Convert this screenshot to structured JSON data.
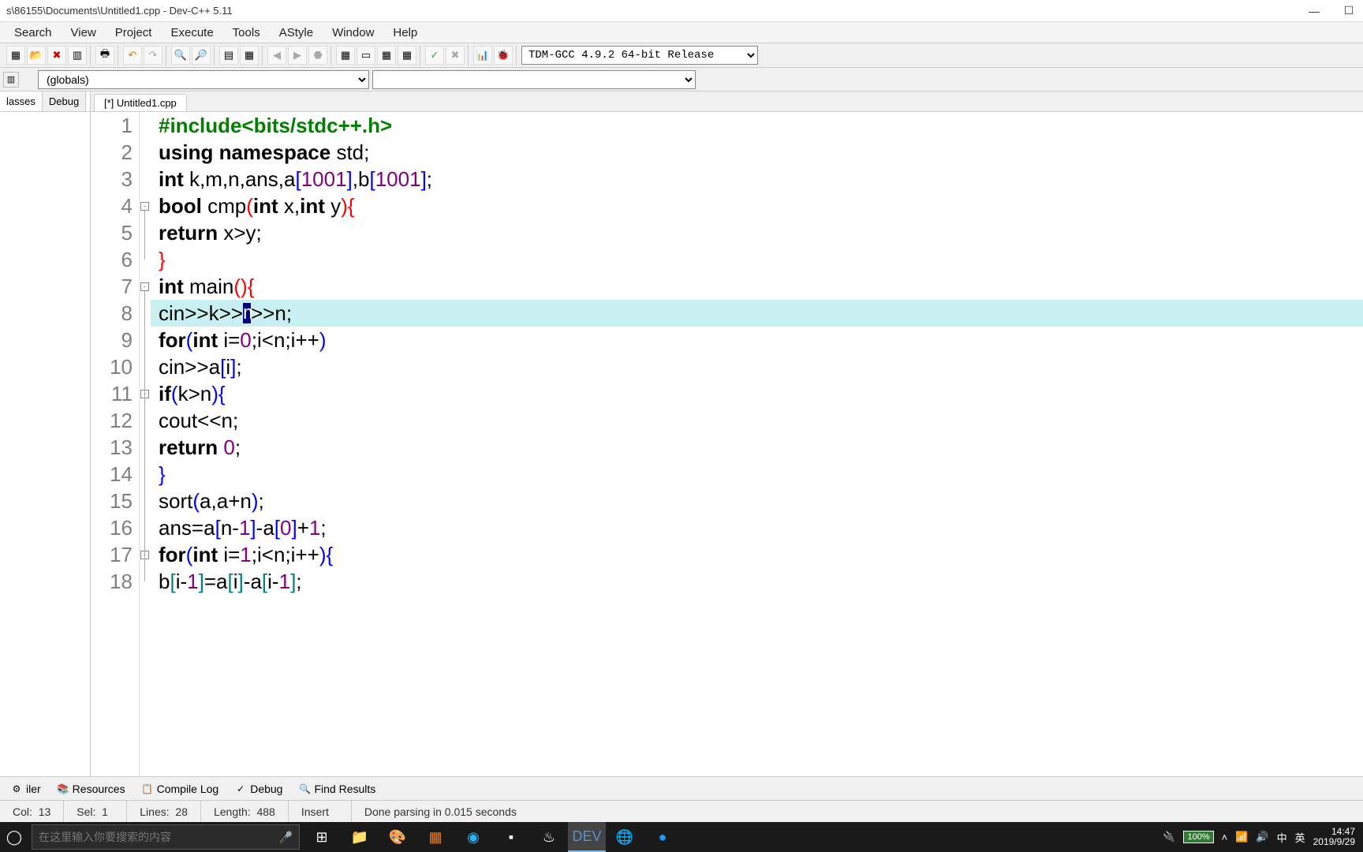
{
  "window": {
    "title": "s\\86155\\Documents\\Untitled1.cpp - Dev-C++ 5.11"
  },
  "menu": [
    "Search",
    "View",
    "Project",
    "Execute",
    "Tools",
    "AStyle",
    "Window",
    "Help"
  ],
  "compiler_selector": "TDM-GCC 4.9.2 64-bit Release",
  "globals_selector": "(globals)",
  "left_tabs": [
    "lasses",
    "Debug"
  ],
  "editor_tab": "[*] Untitled1.cpp",
  "code_lines": [
    {
      "n": 1,
      "tokens": [
        [
          "pp",
          "#include<bits/stdc++.h>"
        ]
      ]
    },
    {
      "n": 2,
      "tokens": [
        [
          "kw",
          "using"
        ],
        [
          "id",
          " "
        ],
        [
          "kw",
          "namespace"
        ],
        [
          "id",
          " std"
        ],
        [
          "op",
          ";"
        ]
      ]
    },
    {
      "n": 3,
      "tokens": [
        [
          "kw",
          "int"
        ],
        [
          "id",
          " k"
        ],
        [
          "op",
          ","
        ],
        [
          "id",
          "m"
        ],
        [
          "op",
          ","
        ],
        [
          "id",
          "n"
        ],
        [
          "op",
          ","
        ],
        [
          "id",
          "ans"
        ],
        [
          "op",
          ","
        ],
        [
          "id",
          "a"
        ],
        [
          "br1",
          "["
        ],
        [
          "num",
          "1001"
        ],
        [
          "br1",
          "]"
        ],
        [
          "op",
          ","
        ],
        [
          "id",
          "b"
        ],
        [
          "br1",
          "["
        ],
        [
          "num",
          "1001"
        ],
        [
          "br1",
          "]"
        ],
        [
          "op",
          ";"
        ]
      ]
    },
    {
      "n": 4,
      "fold": true,
      "tokens": [
        [
          "kw",
          "bool"
        ],
        [
          "id",
          " cmp"
        ],
        [
          "br0",
          "("
        ],
        [
          "kw",
          "int"
        ],
        [
          "id",
          " x"
        ],
        [
          "op",
          ","
        ],
        [
          "kw",
          "int"
        ],
        [
          "id",
          " y"
        ],
        [
          "br0",
          ")"
        ],
        [
          "br0",
          "{"
        ]
      ]
    },
    {
      "n": 5,
      "indent": 1,
      "tokens": [
        [
          "kw",
          "return"
        ],
        [
          "id",
          " x"
        ],
        [
          "op",
          ">"
        ],
        [
          "id",
          "y"
        ],
        [
          "op",
          ";"
        ]
      ]
    },
    {
      "n": 6,
      "tokens": [
        [
          "br0",
          "}"
        ]
      ]
    },
    {
      "n": 7,
      "fold": true,
      "tokens": [
        [
          "kw",
          "int"
        ],
        [
          "id",
          " main"
        ],
        [
          "br0",
          "("
        ],
        [
          "br0",
          ")"
        ],
        [
          "br0",
          "{"
        ]
      ]
    },
    {
      "n": 8,
      "indent": 1,
      "hl": true,
      "tokens": [
        [
          "id",
          "cin"
        ],
        [
          "op",
          ">>"
        ],
        [
          "id",
          "k"
        ],
        [
          "op",
          ">>"
        ],
        [
          "caret",
          "m"
        ],
        [
          "op",
          ">>"
        ],
        [
          "id",
          "n"
        ],
        [
          "op",
          ";"
        ]
      ]
    },
    {
      "n": 9,
      "indent": 1,
      "tokens": [
        [
          "kw",
          "for"
        ],
        [
          "br1",
          "("
        ],
        [
          "kw",
          "int"
        ],
        [
          "id",
          " i"
        ],
        [
          "op",
          "="
        ],
        [
          "num",
          "0"
        ],
        [
          "op",
          ";"
        ],
        [
          "id",
          "i"
        ],
        [
          "op",
          "<"
        ],
        [
          "id",
          "n"
        ],
        [
          "op",
          ";"
        ],
        [
          "id",
          "i"
        ],
        [
          "op",
          "++"
        ],
        [
          "br1",
          ")"
        ]
      ]
    },
    {
      "n": 10,
      "indent": 2,
      "tokens": [
        [
          "id",
          "cin"
        ],
        [
          "op",
          ">>"
        ],
        [
          "id",
          "a"
        ],
        [
          "br1",
          "["
        ],
        [
          "id",
          "i"
        ],
        [
          "br1",
          "]"
        ],
        [
          "op",
          ";"
        ]
      ]
    },
    {
      "n": 11,
      "indent": 1,
      "fold": true,
      "tokens": [
        [
          "kw",
          "if"
        ],
        [
          "br1",
          "("
        ],
        [
          "id",
          "k"
        ],
        [
          "op",
          ">"
        ],
        [
          "id",
          "n"
        ],
        [
          "br1",
          ")"
        ],
        [
          "br1",
          "{"
        ]
      ]
    },
    {
      "n": 12,
      "indent": 2,
      "tokens": [
        [
          "id",
          "cout"
        ],
        [
          "op",
          "<<"
        ],
        [
          "id",
          "n"
        ],
        [
          "op",
          ";"
        ]
      ]
    },
    {
      "n": 13,
      "indent": 2,
      "tokens": [
        [
          "kw",
          "return"
        ],
        [
          "id",
          " "
        ],
        [
          "num",
          "0"
        ],
        [
          "op",
          ";"
        ]
      ]
    },
    {
      "n": 14,
      "indent": 1,
      "tokens": [
        [
          "br1",
          "}"
        ]
      ]
    },
    {
      "n": 15,
      "indent": 1,
      "tokens": [
        [
          "id",
          "sort"
        ],
        [
          "br1",
          "("
        ],
        [
          "id",
          "a"
        ],
        [
          "op",
          ","
        ],
        [
          "id",
          "a"
        ],
        [
          "op",
          "+"
        ],
        [
          "id",
          "n"
        ],
        [
          "br1",
          ")"
        ],
        [
          "op",
          ";"
        ]
      ]
    },
    {
      "n": 16,
      "indent": 1,
      "tokens": [
        [
          "id",
          "ans"
        ],
        [
          "op",
          "="
        ],
        [
          "id",
          "a"
        ],
        [
          "br1",
          "["
        ],
        [
          "id",
          "n"
        ],
        [
          "op",
          "-"
        ],
        [
          "num",
          "1"
        ],
        [
          "br1",
          "]"
        ],
        [
          "op",
          "-"
        ],
        [
          "id",
          "a"
        ],
        [
          "br1",
          "["
        ],
        [
          "num",
          "0"
        ],
        [
          "br1",
          "]"
        ],
        [
          "op",
          "+"
        ],
        [
          "num",
          "1"
        ],
        [
          "op",
          ";"
        ]
      ]
    },
    {
      "n": 17,
      "indent": 1,
      "fold": true,
      "tokens": [
        [
          "kw",
          "for"
        ],
        [
          "br1",
          "("
        ],
        [
          "kw",
          "int"
        ],
        [
          "id",
          " i"
        ],
        [
          "op",
          "="
        ],
        [
          "num",
          "1"
        ],
        [
          "op",
          ";"
        ],
        [
          "id",
          "i"
        ],
        [
          "op",
          "<"
        ],
        [
          "id",
          "n"
        ],
        [
          "op",
          ";"
        ],
        [
          "id",
          "i"
        ],
        [
          "op",
          "++"
        ],
        [
          "br1",
          ")"
        ],
        [
          "br1",
          "{"
        ]
      ]
    },
    {
      "n": 18,
      "indent": 2,
      "tokens": [
        [
          "id",
          "b"
        ],
        [
          "br2",
          "["
        ],
        [
          "id",
          "i"
        ],
        [
          "op",
          "-"
        ],
        [
          "num",
          "1"
        ],
        [
          "br2",
          "]"
        ],
        [
          "op",
          "="
        ],
        [
          "id",
          "a"
        ],
        [
          "br2",
          "["
        ],
        [
          "id",
          "i"
        ],
        [
          "br2",
          "]"
        ],
        [
          "op",
          "-"
        ],
        [
          "id",
          "a"
        ],
        [
          "br2",
          "["
        ],
        [
          "id",
          "i"
        ],
        [
          "op",
          "-"
        ],
        [
          "num",
          "1"
        ],
        [
          "br2",
          "]"
        ],
        [
          "op",
          ";"
        ]
      ]
    }
  ],
  "bottom_tabs": [
    {
      "icon": "⚙",
      "label": "iler"
    },
    {
      "icon": "📚",
      "label": "Resources"
    },
    {
      "icon": "📋",
      "label": "Compile Log"
    },
    {
      "icon": "✓",
      "label": "Debug"
    },
    {
      "icon": "🔍",
      "label": "Find Results"
    }
  ],
  "status": {
    "col_label": "Col:",
    "col": "13",
    "sel_label": "Sel:",
    "sel": "1",
    "lines_label": "Lines:",
    "lines": "28",
    "length_label": "Length:",
    "length": "488",
    "mode": "Insert",
    "parse": "Done parsing in 0.015 seconds"
  },
  "taskbar": {
    "search_placeholder": "在这里输入你要搜索的内容",
    "battery": "100%",
    "ime1": "中",
    "ime2": "英",
    "time": "14:47",
    "date": "2019/9/29"
  }
}
